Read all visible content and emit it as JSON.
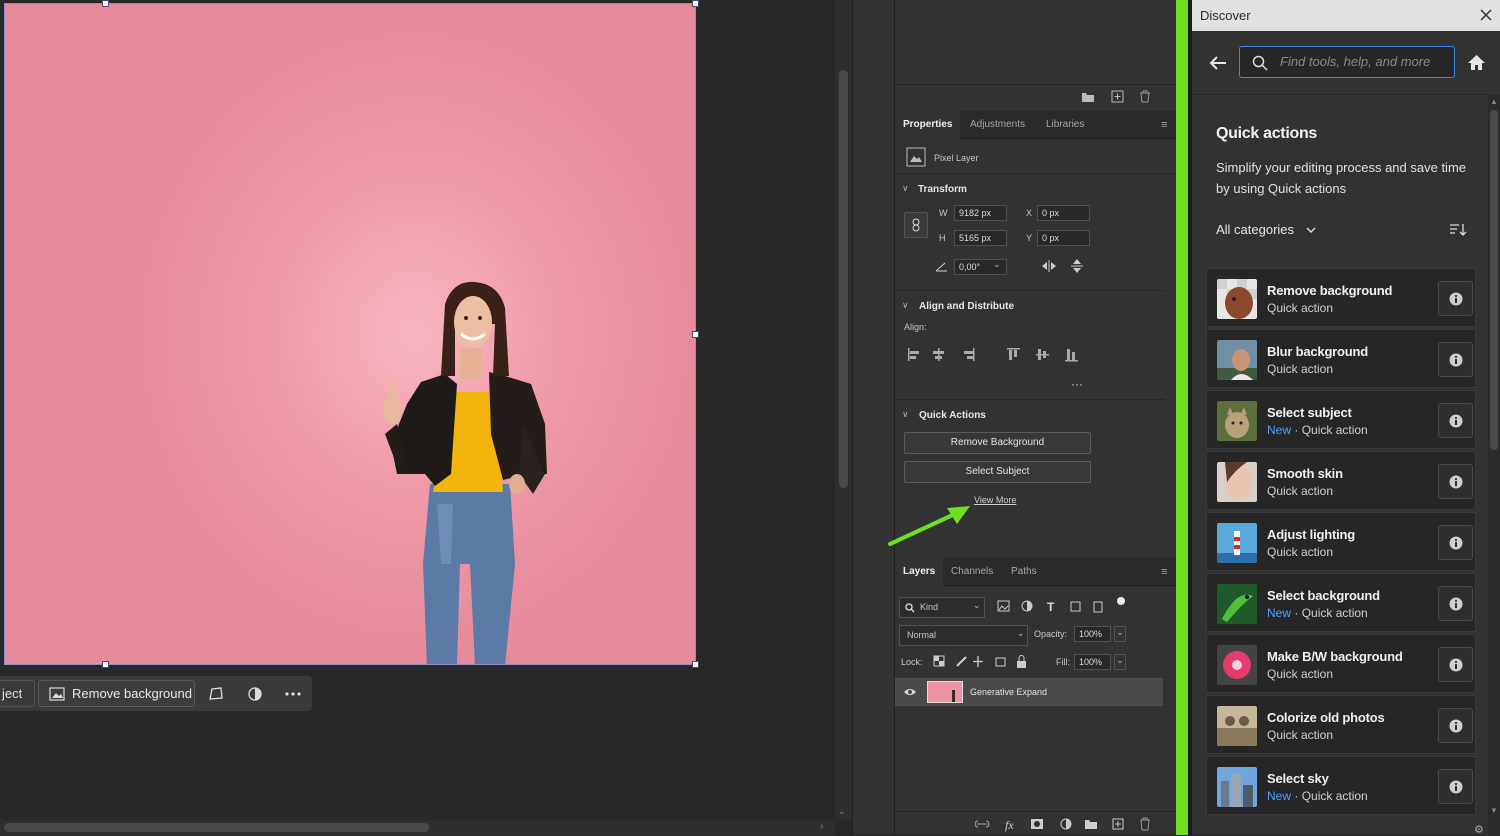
{
  "canvas": {
    "context_bar": {
      "prev_label": "ject",
      "remove_bg_label": "Remove background"
    }
  },
  "properties": {
    "tabs": [
      "Properties",
      "Adjustments",
      "Libraries"
    ],
    "layer_type": "Pixel Layer",
    "transform": {
      "title": "Transform",
      "w_label": "W",
      "w_value": "9182 px",
      "h_label": "H",
      "h_value": "5165 px",
      "x_label": "X",
      "x_value": "0 px",
      "y_label": "Y",
      "y_value": "0 px",
      "angle_value": "0,00°"
    },
    "align": {
      "title": "Align and Distribute",
      "align_label": "Align:"
    },
    "quick_actions": {
      "title": "Quick Actions",
      "remove_bg": "Remove Background",
      "select_subject": "Select Subject",
      "view_more": "View More"
    }
  },
  "layers": {
    "tabs": [
      "Layers",
      "Channels",
      "Paths"
    ],
    "filter_kind": "Kind",
    "blend_mode": "Normal",
    "opacity_label": "Opacity:",
    "opacity_value": "100%",
    "lock_label": "Lock:",
    "fill_label": "Fill:",
    "fill_value": "100%",
    "layer_name": "Generative Expand"
  },
  "discover": {
    "title": "Discover",
    "search_placeholder": "Find tools, help, and more",
    "heading": "Quick actions",
    "description": "Simplify your editing process and save time by using Quick actions",
    "category_label": "All categories",
    "items": [
      {
        "title": "Remove background",
        "is_new": false,
        "sub": "Quick action",
        "icon": "dog-thumbnail"
      },
      {
        "title": "Blur background",
        "is_new": false,
        "sub": "Quick action",
        "icon": "man-portrait-thumbnail"
      },
      {
        "title": "Select subject",
        "is_new": true,
        "new_label": "New",
        "sub": "Quick action",
        "icon": "cat-thumbnail"
      },
      {
        "title": "Smooth skin",
        "is_new": false,
        "sub": "Quick action",
        "icon": "face-thumbnail"
      },
      {
        "title": "Adjust lighting",
        "is_new": false,
        "sub": "Quick action",
        "icon": "lighthouse-thumbnail"
      },
      {
        "title": "Select background",
        "is_new": true,
        "new_label": "New",
        "sub": "Quick action",
        "icon": "lizard-thumbnail"
      },
      {
        "title": "Make B/W background",
        "is_new": false,
        "sub": "Quick action",
        "icon": "flower-thumbnail"
      },
      {
        "title": "Colorize old photos",
        "is_new": false,
        "sub": "Quick action",
        "icon": "old-photo-thumbnail"
      },
      {
        "title": "Select sky",
        "is_new": true,
        "new_label": "New",
        "sub": "Quick action",
        "icon": "city-sky-thumbnail"
      }
    ]
  },
  "colors": {
    "accent_green": "#6fe01f",
    "search_focus": "#3b86e8",
    "new_badge": "#4da3ff",
    "canvas_bg": "#e78a9b"
  }
}
